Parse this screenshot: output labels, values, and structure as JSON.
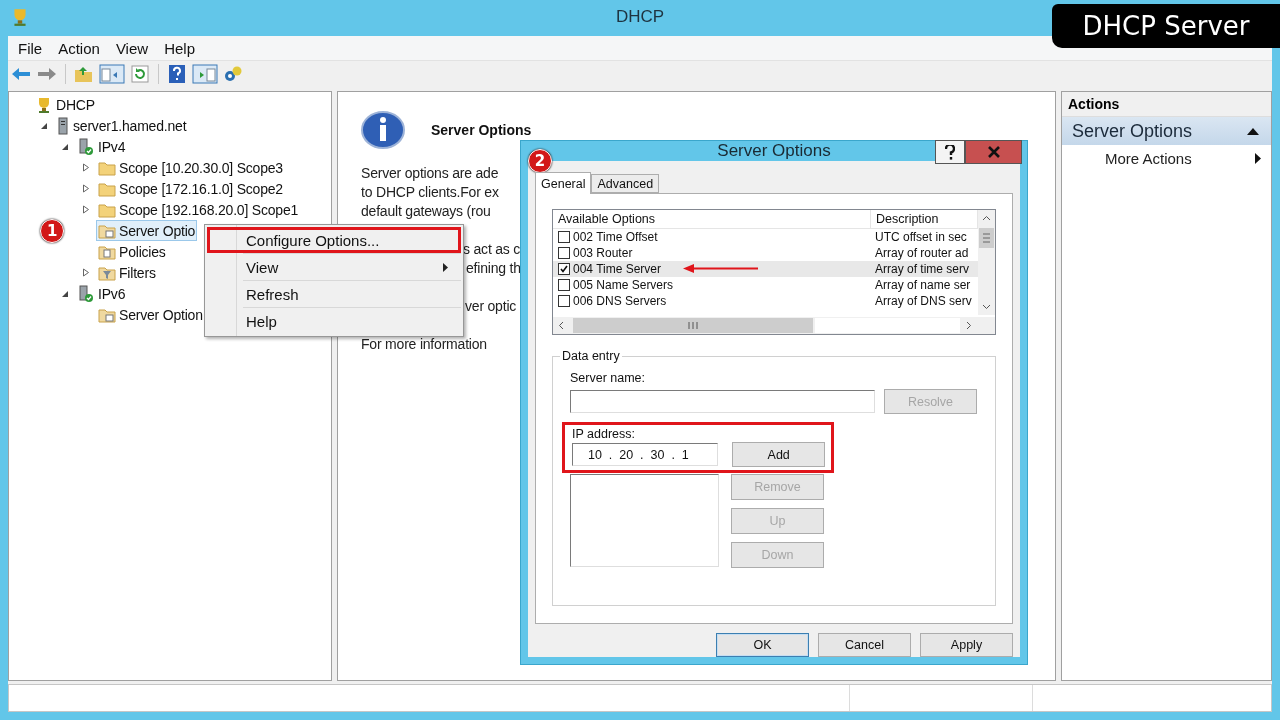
{
  "window": {
    "title": "DHCP"
  },
  "banner": {
    "title": "DHCP Server"
  },
  "menu_bar": [
    "File",
    "Action",
    "View",
    "Help"
  ],
  "tree": [
    {
      "label": "DHCP",
      "kind": "root",
      "selected": false,
      "children": [
        {
          "label": "server1.hamed.net",
          "kind": "server",
          "expanded": true,
          "selected": false,
          "children": [
            {
              "label": "IPv4",
              "kind": "protocol",
              "expanded": true,
              "selected": false,
              "children": [
                {
                  "label": "Scope [10.20.30.0] Scope3",
                  "kind": "folder",
                  "expanded": false,
                  "selected": false
                },
                {
                  "label": "Scope [172.16.1.0] Scope2",
                  "kind": "folder",
                  "expanded": false,
                  "selected": false
                },
                {
                  "label": "Scope [192.168.20.0] Scope1",
                  "kind": "folder",
                  "expanded": false,
                  "selected": false
                },
                {
                  "label": "Server Optio",
                  "kind": "options",
                  "selected": true,
                  "marker": "1"
                },
                {
                  "label": "Policies",
                  "kind": "policies",
                  "selected": false
                },
                {
                  "label": "Filters",
                  "kind": "filters",
                  "expanded": false,
                  "selected": false
                }
              ]
            },
            {
              "label": "IPv6",
              "kind": "protocol",
              "expanded": true,
              "selected": false,
              "children": [
                {
                  "label": "Server Option",
                  "kind": "options",
                  "selected": false
                }
              ]
            }
          ]
        }
      ]
    }
  ],
  "context_menu": [
    {
      "label": "Configure Options...",
      "has_submenu": false,
      "annotated": true
    },
    {
      "label": "View",
      "has_submenu": true,
      "annotated": false
    },
    {
      "label": "Refresh",
      "has_submenu": false,
      "annotated": false
    },
    {
      "label": "Help",
      "has_submenu": false,
      "annotated": false
    }
  ],
  "info": {
    "title": "Server Options",
    "paragraph_1": [
      "Server options are ade",
      "to DHCP clients.For ex",
      "default gateways (rou"
    ],
    "paragraph_2": [
      "s act as c",
      "efining th"
    ],
    "paragraph_3": [
      "ver optic"
    ],
    "footer": "For more information"
  },
  "actions": {
    "header": "Actions",
    "section": {
      "title": "Server Options",
      "expanded": true
    },
    "items": [
      {
        "label": "More Actions",
        "has_submenu": true
      }
    ]
  },
  "dialog": {
    "title": "Server Options",
    "marker": "2",
    "tabs": [
      {
        "label": "General",
        "selected": true
      },
      {
        "label": "Advanced",
        "selected": false
      }
    ],
    "options_list": {
      "columns": [
        "Available Options",
        "Description"
      ],
      "rows": [
        {
          "option": "002 Time Offset",
          "description": "UTC offset in sec",
          "checked": false,
          "selected": false,
          "annotated": false
        },
        {
          "option": "003 Router",
          "description": "Array of router ad",
          "checked": false,
          "selected": false,
          "annotated": false
        },
        {
          "option": "004 Time Server",
          "description": "Array of time serv",
          "checked": true,
          "selected": true,
          "annotated": true
        },
        {
          "option": "005 Name Servers",
          "description": "Array of name ser",
          "checked": false,
          "selected": false,
          "annotated": false
        },
        {
          "option": "006 DNS Servers",
          "description": "Array of DNS serv",
          "checked": false,
          "selected": false,
          "annotated": false
        }
      ]
    },
    "data_entry": {
      "legend": "Data entry",
      "server_name": {
        "label": "Server name:"
      },
      "resolve_button": {
        "label": "Resolve",
        "disabled": true
      },
      "ip_address": {
        "label": "IP address:",
        "value": "10  .  20  .  30  .  1",
        "annotated": true
      },
      "add_button": {
        "label": "Add",
        "disabled": false
      },
      "side_buttons": [
        {
          "label": "Remove",
          "disabled": true
        },
        {
          "label": "Up",
          "disabled": true
        },
        {
          "label": "Down",
          "disabled": true
        }
      ]
    },
    "buttons": [
      {
        "label": "OK",
        "default": true
      },
      {
        "label": "Cancel",
        "default": false
      },
      {
        "label": "Apply",
        "default": false
      }
    ]
  }
}
